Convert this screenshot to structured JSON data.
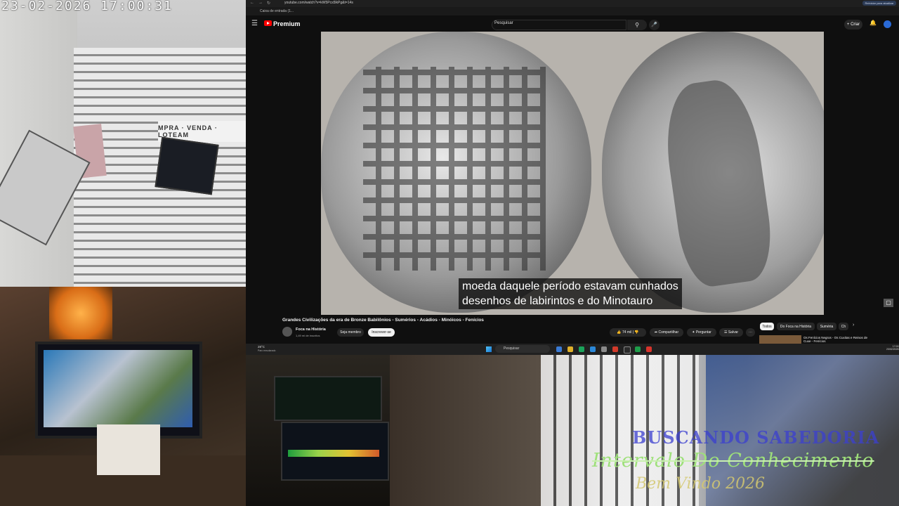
{
  "camera": {
    "timestamp": "23-02-2026 17:00:31",
    "sign_text": "MPRA · VENDA · LOTEAM"
  },
  "browser": {
    "url": "youtube.com/watch?v=kW5Pcs5lkPg&t=14s",
    "update_label": "Reiniciar para atualizar",
    "bookmark": "Caixa de entrada (1..."
  },
  "youtube": {
    "premium_label": "Premium",
    "search_placeholder": "Pesquisar",
    "create_label": "Criar",
    "caption": "moeda daquele período estavam cunhados\ndesenhos de labirintos e do Minotauro",
    "video_title": "Grandes Civilizações da era de Bronze Babilônios - Sumérios - Acádios - Minóicos - Fenícios",
    "channel_name": "Foca na História",
    "channel_subs": "1,49 mi de inscritos",
    "join_label": "Seja membro",
    "subscribe_label": "Inscrever-se",
    "like_count": "74 mil",
    "share_label": "Compartilhar",
    "ask_label": "Perguntar",
    "save_label": "Salvar",
    "chips": [
      "Todos",
      "Do Foca na História",
      "Suméria",
      "Ch"
    ],
    "suggestion_title": "Os Fenícios Negros - Os Cuxitas e Reinos de Cuxe - Fenícios"
  },
  "taskbar": {
    "weather_temp": "28°C",
    "weather_desc": "Parc ensolarado",
    "search_placeholder": "Pesquisar",
    "time": "17:00",
    "date": "23/02/2026"
  },
  "overlay": {
    "line1": "BUSCANDO SABEDORIA",
    "line2": "Intervalo Do Conhecimento",
    "line3": "Bem Vindo 2026"
  }
}
